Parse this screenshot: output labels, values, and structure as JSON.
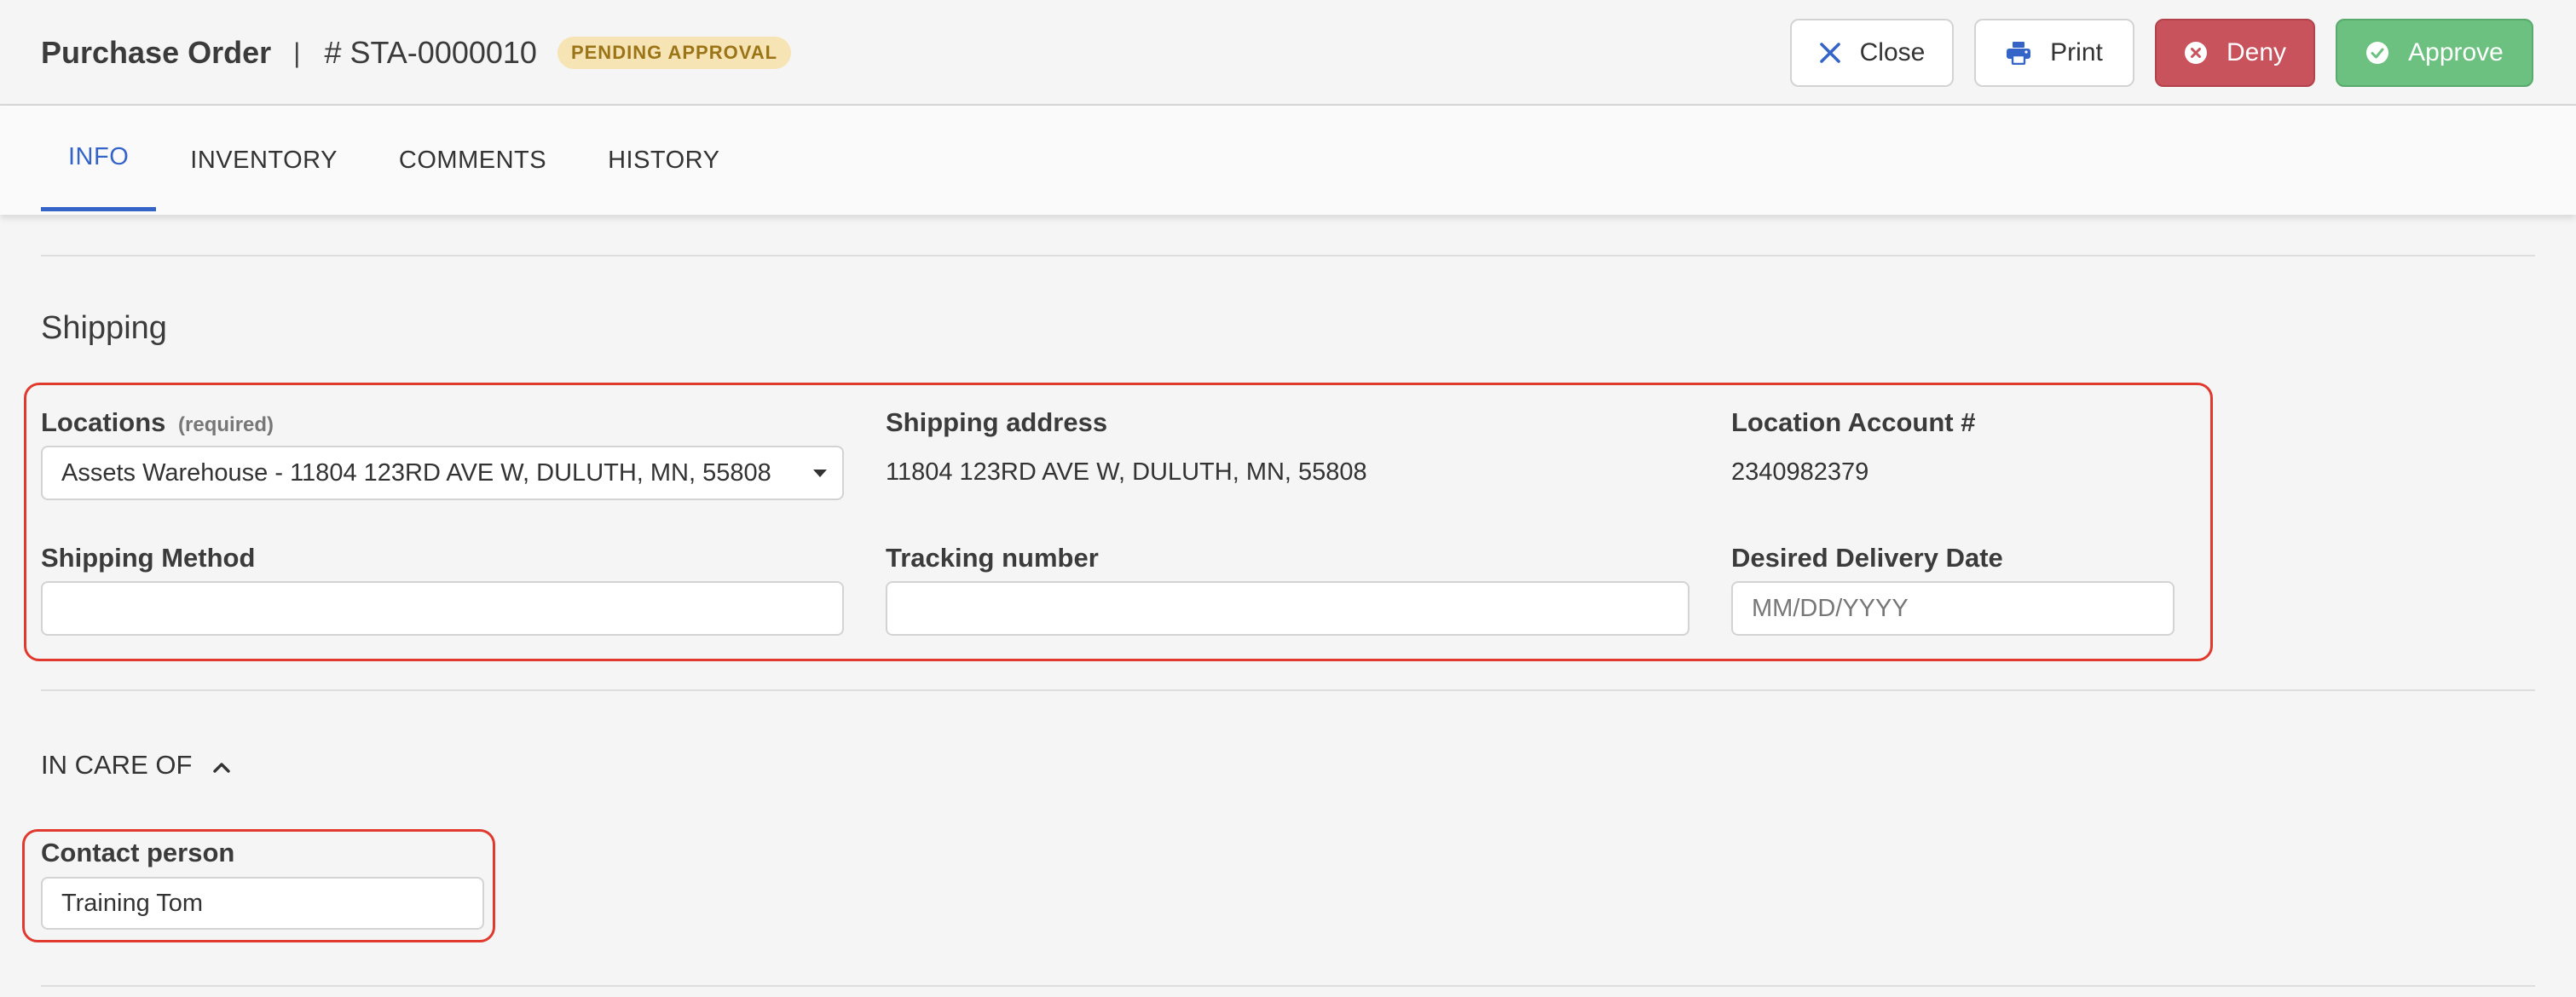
{
  "header": {
    "title": "Purchase Order",
    "separator": "|",
    "po_number": "# STA-0000010",
    "status": "PENDING APPROVAL",
    "status_color": "#f7e4b4"
  },
  "actions": {
    "close_label": "Close",
    "close_icon": "x-icon",
    "print_label": "Print",
    "print_icon": "printer-icon",
    "deny_label": "Deny",
    "deny_icon": "x-circle-icon",
    "deny_color": "#c9535d",
    "approve_label": "Approve",
    "approve_icon": "check-circle-icon",
    "approve_color": "#6cc080"
  },
  "tabs": [
    {
      "label": "INFO",
      "active": true
    },
    {
      "label": "INVENTORY",
      "active": false
    },
    {
      "label": "COMMENTS",
      "active": false
    },
    {
      "label": "HISTORY",
      "active": false
    }
  ],
  "shipping": {
    "section_title": "Shipping",
    "locations_label": "Locations",
    "locations_required": "(required)",
    "locations_value": "Assets Warehouse - 11804 123RD AVE W, DULUTH, MN, 55808",
    "shipping_address_label": "Shipping address",
    "shipping_address_value": "11804 123RD AVE W, DULUTH, MN, 55808",
    "account_label": "Location Account #",
    "account_value": "2340982379",
    "method_label": "Shipping Method",
    "method_value": "",
    "tracking_label": "Tracking number",
    "tracking_value": "",
    "delivery_label": "Desired Delivery Date",
    "delivery_placeholder": "MM/DD/YYYY"
  },
  "in_care_of": {
    "title": "IN CARE OF",
    "toggle_icon": "chevron-up-icon",
    "contact_label": "Contact person",
    "contact_value": "Training Tom"
  },
  "accent_color": "#3564c8",
  "highlight_color": "#e03a2f"
}
